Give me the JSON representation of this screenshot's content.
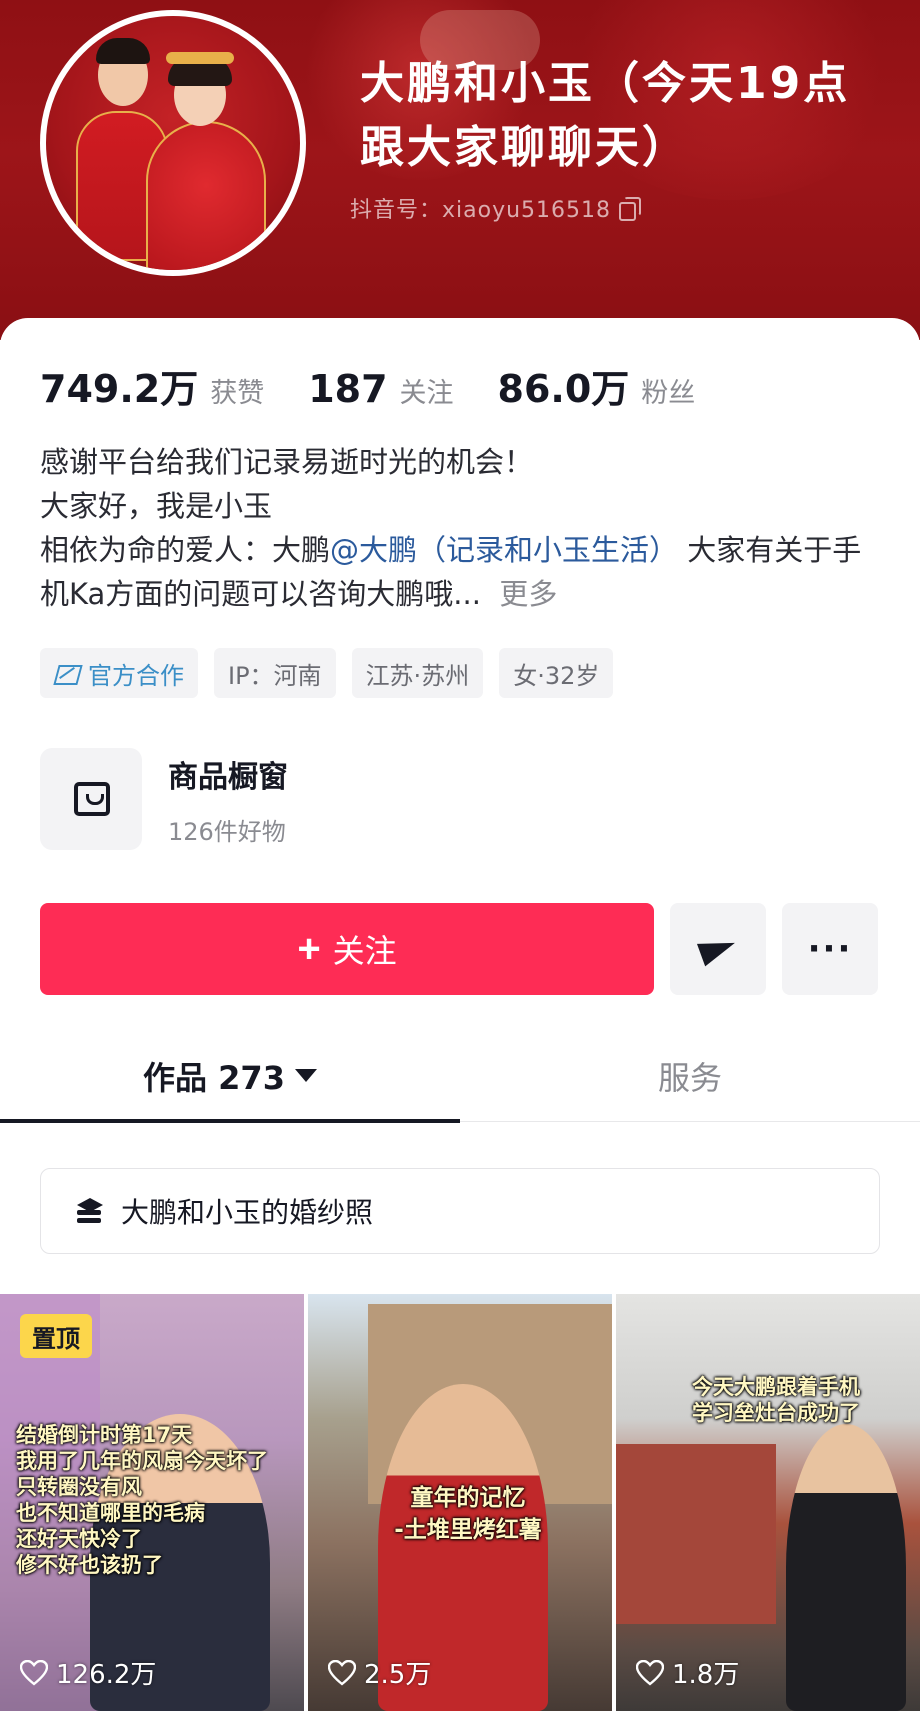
{
  "profile": {
    "display_name": "大鹏和小玉（今天19点跟大家聊聊天）",
    "douyin_id": "抖音号：xiaoyu516518"
  },
  "stats": [
    {
      "value": "749.2万",
      "label": "获赞"
    },
    {
      "value": "187",
      "label": "关注"
    },
    {
      "value": "86.0万",
      "label": "粉丝"
    }
  ],
  "bio": {
    "line1": "感谢平台给我们记录易逝时光的机会！",
    "line2": "大家好，我是小玉",
    "line3_prefix": "相依为命的爱人：大鹏",
    "mention": "@大鹏（记录和小玉生活）",
    "line3_suffix": " 大家有关于手机Ka方面的问题可以咨询大鹏哦...",
    "more": "更多"
  },
  "tags": {
    "official": "官方合作",
    "ip": "IP：河南",
    "location": "江苏·苏州",
    "gender_age": "女·32岁"
  },
  "shop": {
    "title": "商品橱窗",
    "subtitle": "126件好物"
  },
  "actions": {
    "follow_label": "关注",
    "plus": "+",
    "more": "···"
  },
  "tabs": [
    {
      "label": "作品 273",
      "active": true
    },
    {
      "label": "服务",
      "active": false
    }
  ],
  "collection": {
    "label": "大鹏和小玉的婚纱照"
  },
  "videos": [
    {
      "pinned": "置顶",
      "caption": "结婚倒计时第17天\n我用了几年的风扇今天坏了\n只转圈没有风\n也不知道哪里的毛病\n还好天快冷了\n修不好也该扔了",
      "likes": "126.2万"
    },
    {
      "caption": "童年的记忆\n-土堆里烤红薯",
      "likes": "2.5万"
    },
    {
      "caption": "今天大鹏跟着手机\n学习垒灶台成功了",
      "likes": "1.8万"
    }
  ],
  "colors": {
    "banner_red": "#9d1519",
    "follow_button": "#fe2c55",
    "mention_link": "#2b5a9c",
    "official_tag": "#3b8fc7",
    "pin_badge": "#fcd64b"
  }
}
